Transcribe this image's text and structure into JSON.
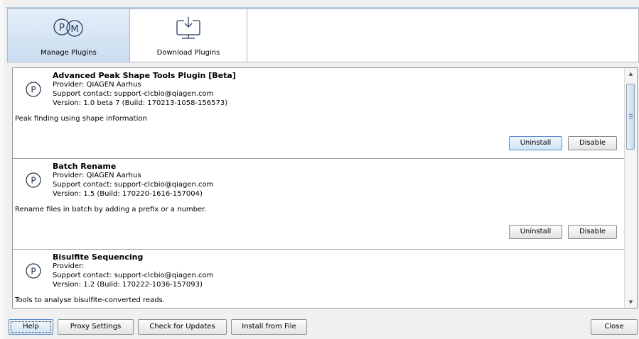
{
  "tabs": [
    {
      "label": "Manage Plugins",
      "icon": "pm-plugins-icon",
      "active": true
    },
    {
      "label": "Download Plugins",
      "icon": "download-monitor-icon",
      "active": false
    }
  ],
  "plugins": [
    {
      "name": "Advanced Peak Shape Tools Plugin [Beta]",
      "provider": "Provider: QIAGEN Aarhus",
      "support": "Support contact: support-clcbio@qiagen.com",
      "version": "Version: 1.0 beta 7 (Build: 170213-1058-156573)",
      "description": "Peak finding using shape information",
      "uninstall_label": "Uninstall",
      "disable_label": "Disable"
    },
    {
      "name": "Batch Rename",
      "provider": "Provider: QIAGEN Aarhus",
      "support": "Support contact: support-clcbio@qiagen.com",
      "version": "Version: 1.5 (Build: 170220-1616-157004)",
      "description": "Rename files in batch by adding a prefix or a number.",
      "uninstall_label": "Uninstall",
      "disable_label": "Disable"
    },
    {
      "name": "Bisulfite Sequencing",
      "provider": "Provider:",
      "support": "Support contact: support-clcbio@qiagen.com",
      "version": "Version: 1.2 (Build: 170222-1036-157093)",
      "description": "Tools to analyse bisulfite-converted reads."
    }
  ],
  "plugin_icon_letter": "P",
  "footer": {
    "help": "Help",
    "proxy": "Proxy Settings",
    "updates": "Check for Updates",
    "install": "Install from File",
    "close": "Close"
  },
  "colors": {
    "active_tab": "#c9dcf0",
    "accent_border": "#5a8cc9"
  }
}
